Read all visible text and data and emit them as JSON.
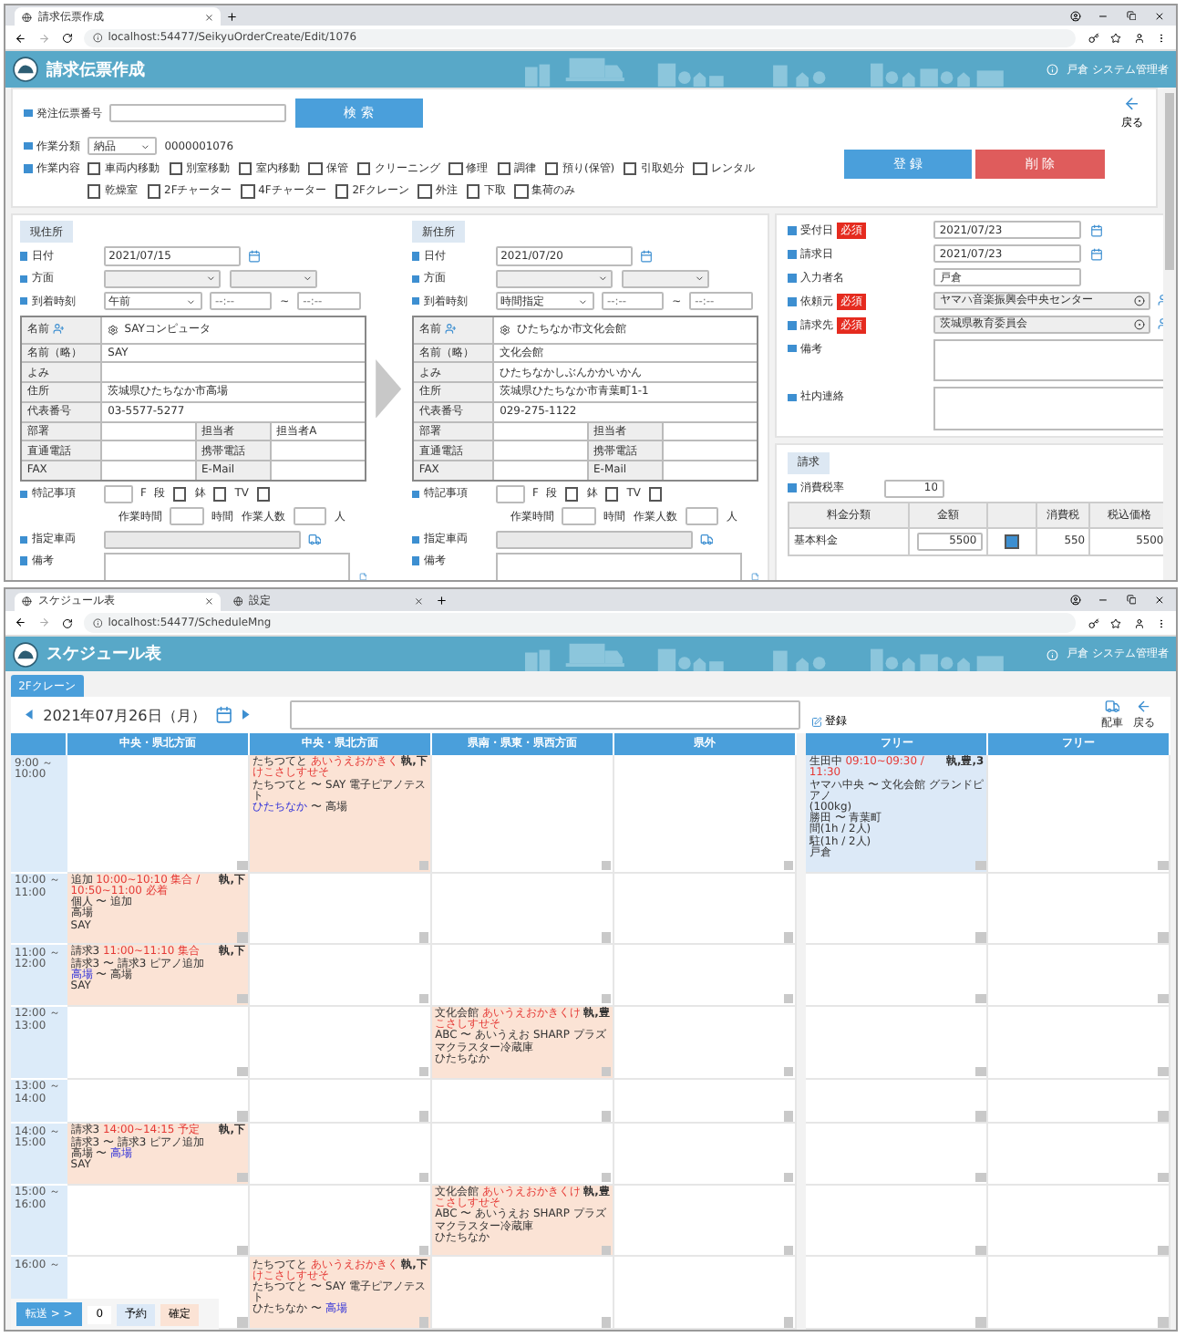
{
  "invoice_window": {
    "tabs": [
      {
        "title": "請求伝票作成",
        "selected": true
      }
    ],
    "url": "localhost:54477/SeikyuOrderCreate/Edit/1076",
    "header": {
      "title": "請求伝票作成",
      "user": "戸倉 システム管理者"
    },
    "search": {
      "label": "発注伝票番号",
      "button": "検 索"
    },
    "back": "戻る",
    "work_type": {
      "label": "作業分類",
      "value": "納品",
      "number": "0000001076"
    },
    "actions": [
      {
        "label": "登 録",
        "kind": "primary"
      },
      {
        "label": "削 除",
        "kind": "danger"
      }
    ],
    "work_content": {
      "label": "作業内容",
      "options": [
        {
          "label": "車両内移動",
          "checked": false
        },
        {
          "label": "別室移動",
          "checked": false
        },
        {
          "label": "室内移動",
          "checked": false
        },
        {
          "label": "保管",
          "checked": false
        },
        {
          "label": "クリーニング",
          "checked": false
        },
        {
          "label": "修理",
          "checked": false
        },
        {
          "label": "調律",
          "checked": false
        },
        {
          "label": "預り(保管)",
          "checked": false
        },
        {
          "label": "引取処分",
          "checked": false
        },
        {
          "label": "レンタル",
          "checked": false
        },
        {
          "label": "乾燥室",
          "checked": false
        },
        {
          "label": "2Fチャーター",
          "checked": false
        },
        {
          "label": "4Fチャーター",
          "checked": false
        },
        {
          "label": "2Fクレーン",
          "checked": false
        },
        {
          "label": "外注",
          "checked": false
        },
        {
          "label": "下取",
          "checked": false
        },
        {
          "label": "集荷のみ",
          "checked": false
        }
      ]
    },
    "addresses": [
      {
        "heading": "現住所",
        "date": {
          "label": "日付",
          "value": "2021/07/15"
        },
        "direction": {
          "label": "方面"
        },
        "arrival": {
          "label": "到着時刻",
          "value": "午前",
          "from_placeholder": "--:--",
          "sep": "~",
          "to_placeholder": "--:--"
        },
        "contact": [
          {
            "label": "名前",
            "value": "SAYコンピュータ",
            "kind": "name"
          },
          {
            "label": "名前（略）",
            "value": "SAY",
            "kind": "single"
          },
          {
            "label": "よみ",
            "kind": "single"
          },
          {
            "label": "住所",
            "value": "茨城県ひたちなか市高場",
            "kind": "single"
          },
          {
            "label": "代表番号",
            "value": "03-5577-5277",
            "kind": "single"
          },
          {
            "label": "部署",
            "label2": "担当者",
            "value2": "担当者A",
            "kind": "pair"
          },
          {
            "label": "直通電話",
            "label2": "携帯電話",
            "kind": "pair"
          },
          {
            "label": "FAX",
            "label2": "E-Mail",
            "kind": "pair"
          }
        ],
        "special": {
          "label": "特記事項",
          "unit": "F",
          "checks": [
            {
              "label": "段",
              "checked": false
            },
            {
              "label": "鉢",
              "checked": false
            },
            {
              "label": "TV",
              "checked": false
            }
          ]
        },
        "work": {
          "time_label": "作業時間",
          "time_unit": "時間",
          "people_label": "作業人数",
          "people_unit": "人"
        },
        "vehicle": {
          "label": "指定車両"
        },
        "remarks": {
          "label": "備考"
        }
      },
      {
        "heading": "新住所",
        "date": {
          "label": "日付",
          "value": "2021/07/20"
        },
        "direction": {
          "label": "方面"
        },
        "arrival": {
          "label": "到着時刻",
          "value": "時間指定",
          "from_placeholder": "--:--",
          "sep": "~",
          "to_placeholder": "--:--"
        },
        "contact": [
          {
            "label": "名前",
            "value": "ひたちなか市文化会館",
            "kind": "name"
          },
          {
            "label": "名前（略）",
            "value": "文化会館",
            "kind": "single"
          },
          {
            "label": "よみ",
            "value": "ひたちなかしぶんかかいかん",
            "kind": "single"
          },
          {
            "label": "住所",
            "value": "茨城県ひたちなか市青葉町1-1",
            "kind": "single"
          },
          {
            "label": "代表番号",
            "value": "029-275-1122",
            "kind": "single"
          },
          {
            "label": "部署",
            "label2": "担当者",
            "kind": "pair"
          },
          {
            "label": "直通電話",
            "label2": "携帯電話",
            "kind": "pair"
          },
          {
            "label": "FAX",
            "label2": "E-Mail",
            "kind": "pair"
          }
        ],
        "special": {
          "label": "特記事項",
          "unit": "F",
          "checks": [
            {
              "label": "段",
              "checked": false
            },
            {
              "label": "鉢",
              "checked": false
            },
            {
              "label": "TV",
              "checked": false
            }
          ]
        },
        "work": {
          "time_label": "作業時間",
          "time_unit": "時間",
          "people_label": "作業人数",
          "people_unit": "人"
        },
        "vehicle": {
          "label": "指定車両"
        },
        "remarks": {
          "label": "備考"
        }
      }
    ],
    "side": [
      {
        "label": "受付日",
        "badge": "必須",
        "value": "2021/07/23",
        "kind": "date"
      },
      {
        "label": "請求日",
        "value": "2021/07/23",
        "kind": "date"
      },
      {
        "label": "入力者名",
        "value": "戸倉",
        "kind": "text"
      },
      {
        "label": "依頼元",
        "badge": "必須",
        "value": "ヤマハ音楽振興会中央センター",
        "kind": "lookup"
      },
      {
        "label": "請求先",
        "badge": "必須",
        "value": "茨城県教育委員会",
        "kind": "lookup"
      },
      {
        "label": "備考",
        "kind": "area"
      },
      {
        "label": "社内連絡",
        "kind": "area"
      }
    ],
    "billing": {
      "heading": "請求",
      "tax_label": "消費税率",
      "tax": "10",
      "columns": [
        "料金分類",
        "金額",
        "消費税",
        "税込価格"
      ],
      "rows": [
        {
          "category": "基本料金",
          "amount": "5500",
          "taxable": true,
          "tax": "550",
          "total": "5500"
        }
      ]
    }
  },
  "schedule_window": {
    "tabs": [
      {
        "title": "スケジュール表",
        "selected": true
      },
      {
        "title": "設定",
        "selected": false
      }
    ],
    "url": "localhost:54477/ScheduleMng",
    "header": {
      "title": "スケジュール表",
      "user": "戸倉 システム管理者"
    },
    "chip": "2Fクレーン",
    "date": "2021年07月26日（月）",
    "register": "登録",
    "tools": [
      {
        "label": "配車",
        "kind": "dispatch"
      },
      {
        "label": "戻る",
        "kind": "back"
      }
    ],
    "column_groups": [
      {
        "columns": [
          {
            "title": "中央・県北方面"
          },
          {
            "title": "中央・県北方面"
          },
          {
            "title": "県南・県東・県西方面"
          },
          {
            "title": "県外"
          }
        ]
      },
      {
        "columns": [
          {
            "title": "フリー"
          },
          {
            "title": "フリー"
          }
        ]
      }
    ],
    "slots": [
      {
        "start": "9:00 ～",
        "end": "10:00",
        "cells": [
          {
            "kind": "empty"
          },
          {
            "kind": "event",
            "color": "#fbe3d5",
            "head": [
              {
                "text": "たちつてと ",
                "kind": "plain"
              },
              {
                "text": "あいうえおかきくけこさしすせそ",
                "kind": "alert"
              }
            ],
            "tag": "執,下",
            "lines": [
              [
                {
                  "text": "たちつてと 〜 SAY 電子ピアノテスト",
                  "kind": "plain"
                }
              ],
              [
                {
                  "text": "ひたちなか",
                  "kind": "place"
                },
                {
                  "text": " 〜 高場",
                  "kind": "plain"
                }
              ]
            ]
          },
          {
            "kind": "empty"
          },
          {
            "kind": "empty"
          },
          {
            "kind": "event",
            "color": "#dce9f7",
            "head": [
              {
                "text": "生田中 ",
                "kind": "plain"
              },
              {
                "text": "09:10~09:30 / 11:30",
                "kind": "alert"
              }
            ],
            "tag": "執,豊,3",
            "lines": [
              [
                {
                  "text": "ヤマハ中央 〜 文化会館 グランドピアノ",
                  "kind": "plain"
                }
              ],
              [
                {
                  "text": "(100kg)",
                  "kind": "plain"
                }
              ],
              [
                {
                  "text": "勝田 〜 青葉町",
                  "kind": "plain"
                }
              ],
              [
                {
                  "text": "間(1h / 2人)",
                  "kind": "plain"
                }
              ],
              [
                {
                  "text": "駐(1h / 2人)",
                  "kind": "plain"
                }
              ],
              [
                {
                  "text": "戸倉",
                  "kind": "plain"
                }
              ]
            ]
          },
          {
            "kind": "empty"
          }
        ]
      },
      {
        "start": "10:00 ～",
        "end": "11:00",
        "cells": [
          {
            "kind": "event",
            "color": "#fbe3d5",
            "head": [
              {
                "text": "追加 ",
                "kind": "plain"
              },
              {
                "text": "10:00~10:10 集合 / 10:50~11:00 必着",
                "kind": "alert"
              }
            ],
            "tag": "執,下",
            "lines": [
              [
                {
                  "text": "個人 〜 追加",
                  "kind": "plain"
                }
              ],
              [
                {
                  "text": "高場",
                  "kind": "plain"
                }
              ],
              [
                {
                  "text": "SAY",
                  "kind": "plain"
                }
              ]
            ]
          },
          {
            "kind": "empty"
          },
          {
            "kind": "empty"
          },
          {
            "kind": "empty"
          },
          {
            "kind": "empty"
          },
          {
            "kind": "empty"
          }
        ]
      },
      {
        "start": "11:00 ～",
        "end": "12:00",
        "cells": [
          {
            "kind": "event",
            "color": "#fbe3d5",
            "head": [
              {
                "text": "請求3 ",
                "kind": "plain"
              },
              {
                "text": "11:00~11:10 集合",
                "kind": "alert"
              }
            ],
            "tag": "執,下",
            "lines": [
              [
                {
                  "text": "請求3 〜 請求3 ピアノ追加",
                  "kind": "plain"
                }
              ],
              [
                {
                  "text": "高場",
                  "kind": "place"
                },
                {
                  "text": " 〜 高場",
                  "kind": "plain"
                }
              ],
              [
                {
                  "text": "SAY",
                  "kind": "plain"
                }
              ]
            ]
          },
          {
            "kind": "empty"
          },
          {
            "kind": "empty"
          },
          {
            "kind": "empty"
          },
          {
            "kind": "empty"
          },
          {
            "kind": "empty"
          }
        ]
      },
      {
        "start": "12:00 ～",
        "end": "13:00",
        "cells": [
          {
            "kind": "empty"
          },
          {
            "kind": "empty"
          },
          {
            "kind": "event",
            "color": "#fbe3d5",
            "head": [
              {
                "text": "文化会館 ",
                "kind": "plain"
              },
              {
                "text": "あいうえおかきくけこさしすせそ",
                "kind": "alert"
              }
            ],
            "tag": "執,豊",
            "lines": [
              [
                {
                  "text": "ABC 〜 あいうえお SHARP プラズマクラスター冷蔵庫",
                  "kind": "plain"
                }
              ],
              [
                {
                  "text": "ひたちなか",
                  "kind": "plain"
                }
              ]
            ]
          },
          {
            "kind": "empty"
          },
          {
            "kind": "empty"
          },
          {
            "kind": "empty"
          }
        ]
      },
      {
        "start": "13:00 ～",
        "end": "14:00",
        "cells": [
          {
            "kind": "empty"
          },
          {
            "kind": "empty"
          },
          {
            "kind": "empty"
          },
          {
            "kind": "empty"
          },
          {
            "kind": "empty"
          },
          {
            "kind": "empty"
          }
        ]
      },
      {
        "start": "14:00 ～",
        "end": "15:00",
        "cells": [
          {
            "kind": "event",
            "color": "#fbe3d5",
            "head": [
              {
                "text": "請求3 ",
                "kind": "plain"
              },
              {
                "text": "14:00~14:15 予定",
                "kind": "alert"
              }
            ],
            "tag": "執,下",
            "lines": [
              [
                {
                  "text": "請求3 〜 請求3 ピアノ追加",
                  "kind": "plain"
                }
              ],
              [
                {
                  "text": "高場 〜 ",
                  "kind": "plain"
                },
                {
                  "text": "高場",
                  "kind": "place"
                }
              ],
              [
                {
                  "text": "SAY",
                  "kind": "plain"
                }
              ]
            ]
          },
          {
            "kind": "empty"
          },
          {
            "kind": "empty"
          },
          {
            "kind": "empty"
          },
          {
            "kind": "empty"
          },
          {
            "kind": "empty"
          }
        ]
      },
      {
        "start": "15:00 ～",
        "end": "16:00",
        "cells": [
          {
            "kind": "empty"
          },
          {
            "kind": "empty"
          },
          {
            "kind": "event",
            "color": "#fbe3d5",
            "head": [
              {
                "text": "文化会館 ",
                "kind": "plain"
              },
              {
                "text": "あいうえおかきくけこさしすせそ",
                "kind": "alert"
              }
            ],
            "tag": "執,豊",
            "lines": [
              [
                {
                  "text": "ABC 〜 あいうえお SHARP プラズマクラスター冷蔵庫",
                  "kind": "plain"
                }
              ],
              [
                {
                  "text": "ひたちなか",
                  "kind": "plain"
                }
              ]
            ]
          },
          {
            "kind": "empty"
          },
          {
            "kind": "empty"
          },
          {
            "kind": "empty"
          }
        ]
      },
      {
        "start": "16:00 ～",
        "cells": [
          {
            "kind": "empty"
          },
          {
            "kind": "event",
            "color": "#fbe3d5",
            "head": [
              {
                "text": "たちつてと ",
                "kind": "plain"
              },
              {
                "text": "あいうえおかきくけこさしすせそ",
                "kind": "alert"
              }
            ],
            "tag": "執,下",
            "lines": [
              [
                {
                  "text": "たちつてと 〜 SAY 電子ピアノテスト",
                  "kind": "plain"
                }
              ],
              [
                {
                  "text": "ひたちなか 〜 ",
                  "kind": "plain"
                },
                {
                  "text": "高場",
                  "kind": "place"
                }
              ]
            ]
          },
          {
            "kind": "empty"
          },
          {
            "kind": "empty"
          },
          {
            "kind": "empty"
          },
          {
            "kind": "empty"
          }
        ]
      }
    ],
    "transfer": {
      "button": "転送 > >",
      "count": "0"
    },
    "legend": [
      {
        "label": "予約",
        "color": "#dce9f7"
      },
      {
        "label": "確定",
        "color": "#fbe3d5"
      }
    ]
  }
}
